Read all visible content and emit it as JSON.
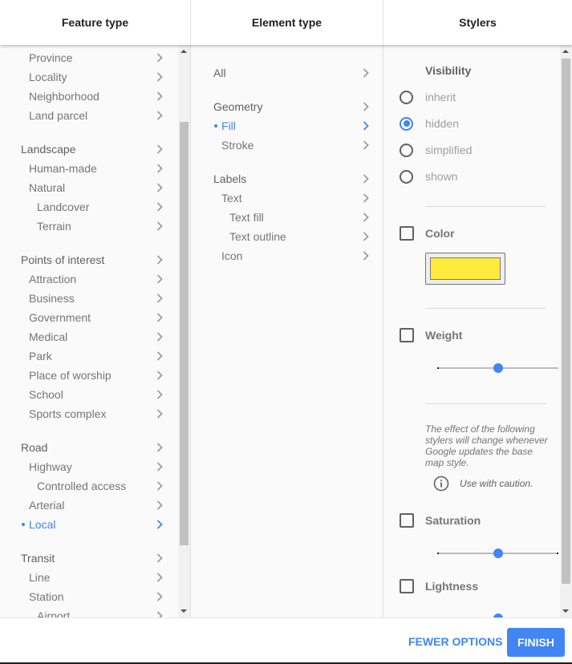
{
  "header": {
    "feature_type": "Feature type",
    "element_type": "Element type",
    "stylers": "Stylers"
  },
  "feature_list": [
    {
      "label": "Province",
      "level": 1
    },
    {
      "label": "Locality",
      "level": 1
    },
    {
      "label": "Neighborhood",
      "level": 1
    },
    {
      "label": "Land parcel",
      "level": 1
    },
    {
      "label": "Landscape",
      "level": 0
    },
    {
      "label": "Human-made",
      "level": 1
    },
    {
      "label": "Natural",
      "level": 1
    },
    {
      "label": "Landcover",
      "level": 2
    },
    {
      "label": "Terrain",
      "level": 2
    },
    {
      "label": "Points of interest",
      "level": 0
    },
    {
      "label": "Attraction",
      "level": 1
    },
    {
      "label": "Business",
      "level": 1
    },
    {
      "label": "Government",
      "level": 1
    },
    {
      "label": "Medical",
      "level": 1
    },
    {
      "label": "Park",
      "level": 1
    },
    {
      "label": "Place of worship",
      "level": 1
    },
    {
      "label": "School",
      "level": 1
    },
    {
      "label": "Sports complex",
      "level": 1
    },
    {
      "label": "Road",
      "level": 0
    },
    {
      "label": "Highway",
      "level": 1
    },
    {
      "label": "Controlled access",
      "level": 2
    },
    {
      "label": "Arterial",
      "level": 1
    },
    {
      "label": "Local",
      "level": 1,
      "active": true
    },
    {
      "label": "Transit",
      "level": 0
    },
    {
      "label": "Line",
      "level": 1
    },
    {
      "label": "Station",
      "level": 1
    },
    {
      "label": "Airport",
      "level": 2
    }
  ],
  "element_list": [
    {
      "label": "All",
      "level": 0
    },
    {
      "label": "Geometry",
      "level": 0
    },
    {
      "label": "Fill",
      "level": 1,
      "active": true
    },
    {
      "label": "Stroke",
      "level": 1
    },
    {
      "label": "Labels",
      "level": 0
    },
    {
      "label": "Text",
      "level": 1
    },
    {
      "label": "Text fill",
      "level": 2
    },
    {
      "label": "Text outline",
      "level": 2
    },
    {
      "label": "Icon",
      "level": 1
    }
  ],
  "stylers": {
    "visibility": {
      "title": "Visibility",
      "options": [
        "inherit",
        "hidden",
        "simplified",
        "shown"
      ],
      "selected": "hidden"
    },
    "color": {
      "label": "Color",
      "checked": false,
      "value": "#ffeb3b"
    },
    "weight": {
      "label": "Weight",
      "checked": false,
      "slider_fraction": 0.5
    },
    "note": "The effect of the following stylers will change whenever Google updates the base map style.",
    "caution": "Use with caution.",
    "saturation": {
      "label": "Saturation",
      "checked": false,
      "slider_fraction": 0.5
    },
    "lightness": {
      "label": "Lightness",
      "checked": false,
      "slider_fraction": 0.5
    }
  },
  "footer": {
    "fewer_options": "FEWER OPTIONS",
    "finish": "FINISH"
  },
  "colors": {
    "accent": "#4285f4",
    "swatch": "#ffeb3b"
  }
}
